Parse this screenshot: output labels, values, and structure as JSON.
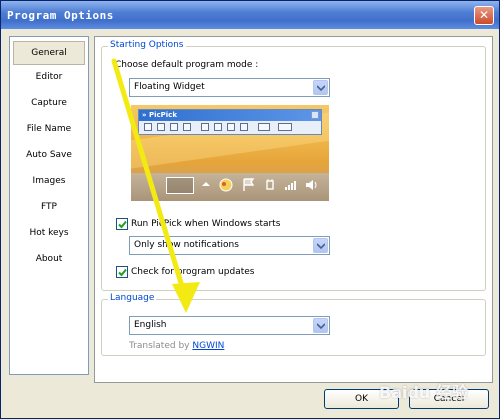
{
  "window": {
    "title": "Program Options",
    "close_glyph": "✕"
  },
  "sidebar": {
    "items": [
      {
        "label": "General"
      },
      {
        "label": "Editor"
      },
      {
        "label": "Capture"
      },
      {
        "label": "File Name"
      },
      {
        "label": "Auto Save"
      },
      {
        "label": "Images"
      },
      {
        "label": "FTP"
      },
      {
        "label": "Hot keys"
      },
      {
        "label": "About"
      }
    ],
    "selected": "General"
  },
  "starting_options": {
    "legend": "Starting Options",
    "mode_label": "Choose default program mode :",
    "mode_value": "Floating Widget",
    "widget_title": "» PicPick",
    "run_on_start_label": "Run PicPick when Windows starts",
    "run_on_start_checked": true,
    "notify_value": "Only show notifications",
    "check_updates_label": "Check for program updates",
    "check_updates_checked": true
  },
  "language": {
    "legend": "Language",
    "value": "English",
    "translated_by_prefix": "Translated by",
    "translator": "NGWIN"
  },
  "footer": {
    "ok_label": "OK",
    "cancel_label": "Cancel"
  },
  "overlay": {
    "watermark_text": "Baidu 经验",
    "arrow_color": "#f2ea12"
  }
}
